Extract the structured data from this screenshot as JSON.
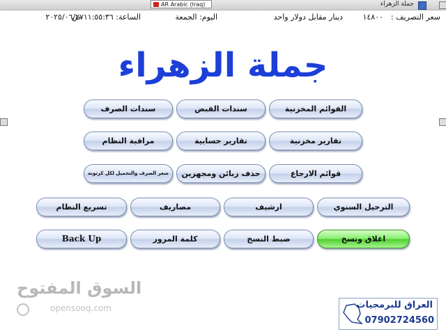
{
  "window": {
    "title": "جملة الزهراء",
    "input_language": "AR Arabic (Iraq)"
  },
  "status": {
    "exchange_label": "سعر التصريف :",
    "exchange_value": "١٤٨٠٠",
    "exchange_unit": "دينار مقابل دولار واحد",
    "day_text": "اليوم:  الجمعة",
    "date": "٢٠٢٥/٠٦/٢٧",
    "time_text": "الساعة: ١١:٥٥:٣٦ ص"
  },
  "header": {
    "title": "جملة الزهراء"
  },
  "menu": {
    "inventory_lists": "القوائم المخزنية",
    "receipt_vouchers": "سندات القبض",
    "payment_vouchers": "سندات الصرف",
    "inventory_reports": "تقارير مخزنية",
    "account_reports": "تقارير حسابية",
    "system_monitor": "مراقبة النظام",
    "return_lists": "قوائم الارجاع",
    "delete_customers": "حذف زبائن ومجهزين",
    "price_per_carton": "سعر الصرف والتحميل لكل كرتونة",
    "yearly_posting": "الترحيل السنوي",
    "archive": "ارشيف",
    "expenses": "مصاريف",
    "speed_system": "تسريع النظام",
    "close_copy": "اغلاق ونسخ",
    "copy_settings": "ضبط النسخ",
    "password": "كلمة المرور",
    "backup": "Back Up"
  },
  "watermark": {
    "arabic": "السوق المفتوح",
    "latin": "opensooq.com"
  },
  "promo": {
    "name": "العراق للبرمجيات",
    "phone": "07902724560"
  }
}
